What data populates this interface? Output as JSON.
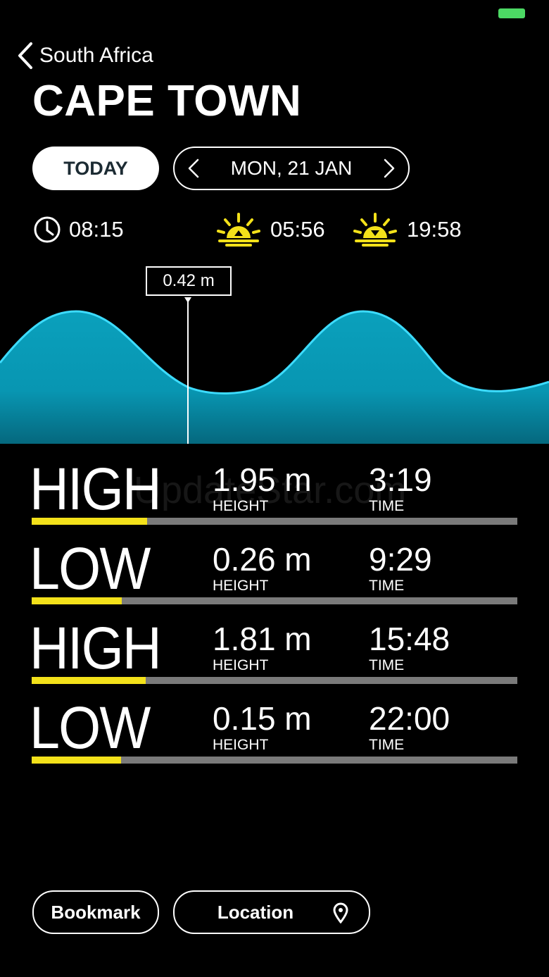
{
  "status_bar": {
    "battery_color": "#4cd964"
  },
  "nav": {
    "back_label": "South Africa",
    "title": "CAPE TOWN"
  },
  "controls": {
    "today_label": "TODAY",
    "date_label": "MON, 21 JAN"
  },
  "info": {
    "current_time": "08:15",
    "sunrise": "05:56",
    "sunset": "19:58",
    "sun_icon_color": "#f3e11a"
  },
  "chart": {
    "marker_label": "0.42 m",
    "wave_color": "#0aa0bc",
    "wave_stroke": "#3ddcff"
  },
  "watermark": "UpdateStar.com",
  "tides": [
    {
      "type": "HIGH",
      "height": "1.95 m",
      "height_caption": "HEIGHT",
      "time": "3:19",
      "time_caption": "TIME",
      "level": 0.237
    },
    {
      "type": "LOW",
      "height": "0.26 m",
      "height_caption": "HEIGHT",
      "time": "9:29",
      "time_caption": "TIME",
      "level": 0.186
    },
    {
      "type": "HIGH",
      "height": "1.81 m",
      "height_caption": "HEIGHT",
      "time": "15:48",
      "time_caption": "TIME",
      "level": 0.235
    },
    {
      "type": "LOW",
      "height": "0.15 m",
      "height_caption": "HEIGHT",
      "time": "22:00",
      "time_caption": "TIME",
      "level": 0.184
    }
  ],
  "bottom": {
    "bookmark_label": "Bookmark",
    "location_label": "Location"
  },
  "colors": {
    "accent_yellow": "#f3e11a",
    "track_gray": "#7a7a7a"
  }
}
